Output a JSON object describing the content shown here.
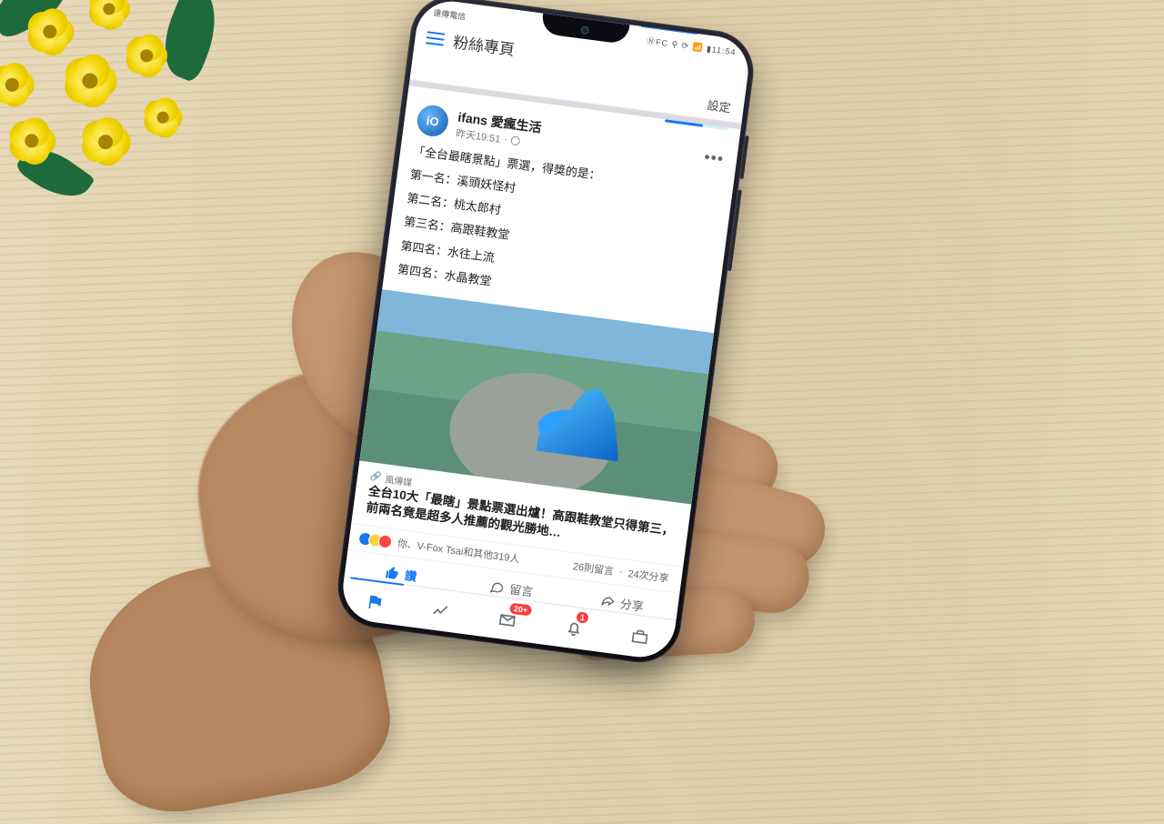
{
  "status_bar": {
    "carrier": "遠傳電信",
    "time": "11:54",
    "icons_right": "ⓃFC ⚲ ⟳ 📶 ▮11:54"
  },
  "app_header": {
    "title": "粉絲專頁",
    "settings": "設定"
  },
  "post": {
    "author": "ifans 愛瘋生活",
    "avatar_initial": "iO",
    "meta_time": "昨天19:51",
    "meta_privacy": "公開",
    "intro": "「全台最瞎景點」票選，得獎的是：",
    "ranks": [
      "第一名：溪頭妖怪村",
      "第二名：桃太郎村",
      "第三名：高跟鞋教堂",
      "第四名：水往上流",
      "第四名：水晶教堂"
    ],
    "link": {
      "source": "風傳媒",
      "title": "全台10大「最瞎」景點票選出爐！高跟鞋教堂只得第三，前兩名竟是超多人推薦的觀光勝地…"
    },
    "reactions": {
      "summary": "你、V-Fox Tsai和其他319人",
      "comments": "26則留言",
      "shares": "24次分享"
    },
    "actions": {
      "like": "讚",
      "comment": "留言",
      "share": "分享"
    }
  },
  "bottom_nav": {
    "badge_inbox": "20+",
    "badge_notif": "1"
  }
}
